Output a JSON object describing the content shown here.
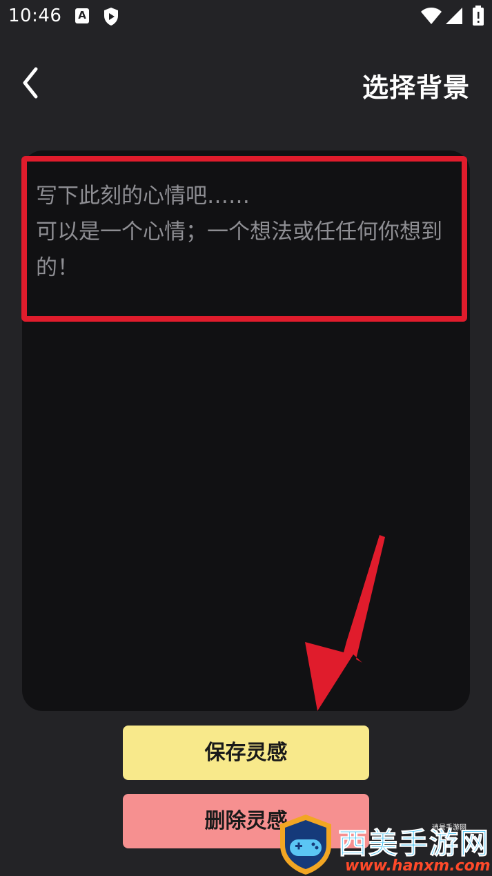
{
  "status_bar": {
    "time": "10:46",
    "a_badge": "A",
    "icons": [
      "a-icon",
      "shield-icon",
      "wifi-icon",
      "signal-icon",
      "battery-icon"
    ]
  },
  "header": {
    "back_icon": "chevron-left-icon",
    "title": "选择背景"
  },
  "note": {
    "placeholder": "写下此刻的心情吧……\n可以是一个心情；一个想法或任任何你想到的！"
  },
  "actions": {
    "save_label": "保存灵感",
    "delete_label": "删除灵感"
  },
  "annotations": {
    "highlight_color": "#e01c2c",
    "arrow_color": "#e01c2c",
    "arrow_icon": "red-arrow-icon"
  },
  "watermark": {
    "title": "西美手游网",
    "sub": "逍景手游网",
    "url": "www.hanxm.com"
  },
  "colors": {
    "background": "#232326",
    "card": "#111113",
    "save_button": "#f8e98b",
    "delete_button": "#f69090"
  }
}
